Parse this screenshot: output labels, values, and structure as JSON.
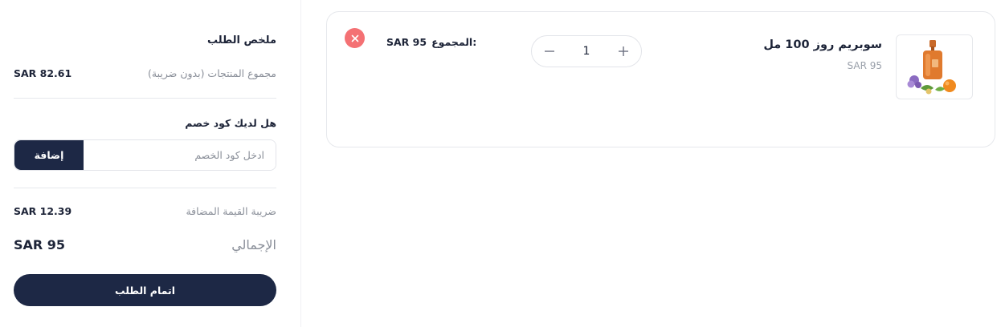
{
  "summary": {
    "title": "ملخص الطلب",
    "subtotal_label": "مجموع المنتجات (بدون ضريبة)",
    "subtotal_value": "SAR 82.61",
    "coupon_question": "هل لديك كود خصم",
    "coupon_placeholder": "ادخل كود الخصم",
    "coupon_button": "إضافة",
    "vat_label": "ضريبة القيمة المضافة",
    "vat_value": "SAR 12.39",
    "total_label": "الإجمالي",
    "total_value": "SAR 95",
    "checkout_button": "اتمام الطلب"
  },
  "cart_item": {
    "name": "سوبريم روز 100 مل",
    "price": "SAR 95",
    "quantity": "1",
    "total_label": "المجموع:",
    "total_value": "SAR 95"
  },
  "icons": {
    "remove": "close-icon",
    "increment": "plus-icon",
    "decrement": "minus-icon",
    "product_image": "perfume-bottle-image"
  },
  "colors": {
    "primary": "#1d2845",
    "remove_red": "#f47174",
    "muted_text": "#8a8f99"
  }
}
